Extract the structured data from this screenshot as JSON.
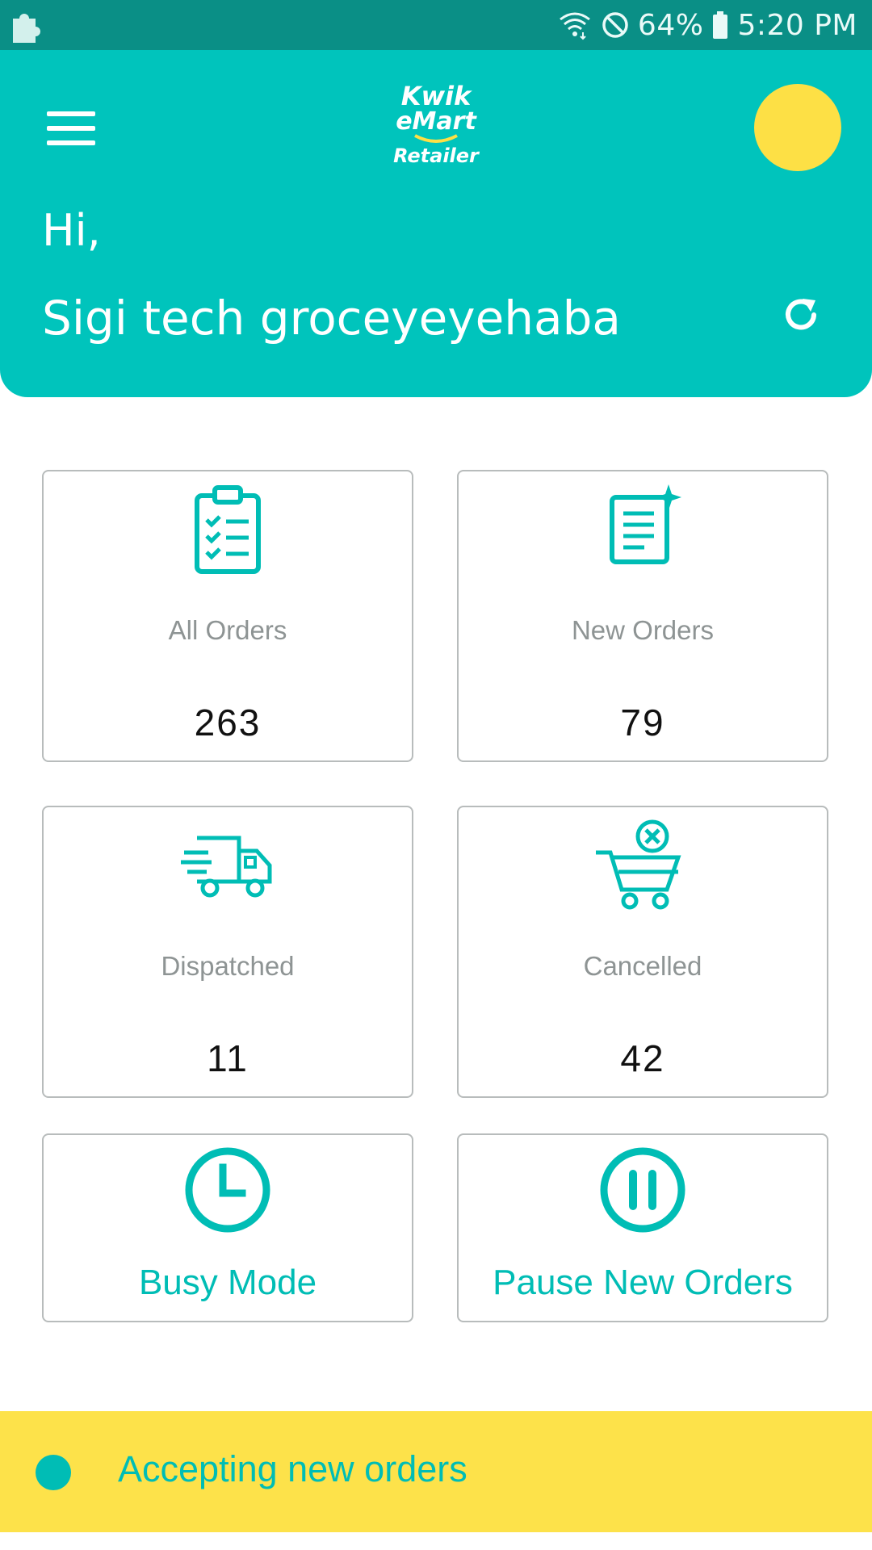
{
  "status_bar": {
    "battery": "64%",
    "time": "5:20 PM",
    "icons": [
      "puzzle-icon",
      "wifi-icon",
      "do-not-disturb-icon",
      "battery-icon"
    ]
  },
  "header": {
    "logo": {
      "line1": "Kwik",
      "line2": "eMart",
      "line3": "Retailer"
    },
    "greeting": "Hi,",
    "store_name": "Sigi tech groceyeyehaba",
    "colors": {
      "background": "#00c4bc",
      "avatar": "#fde045"
    },
    "icons": [
      "menu-icon",
      "refresh-icon"
    ]
  },
  "cards": [
    {
      "label": "All Orders",
      "count": "263",
      "icon": "clipboard-checklist-icon"
    },
    {
      "label": "New Orders",
      "count": "79",
      "icon": "new-document-icon"
    },
    {
      "label": "Dispatched",
      "count": "11",
      "icon": "delivery-truck-icon"
    },
    {
      "label": "Cancelled",
      "count": "42",
      "icon": "cart-cancel-icon"
    }
  ],
  "actions": [
    {
      "label": "Busy Mode",
      "icon": "clock-icon"
    },
    {
      "label": "Pause New Orders",
      "icon": "pause-icon"
    }
  ],
  "footer": {
    "status_text": "Accepting new orders",
    "colors": {
      "background": "#fde24a",
      "accent": "#00bdb5"
    }
  }
}
